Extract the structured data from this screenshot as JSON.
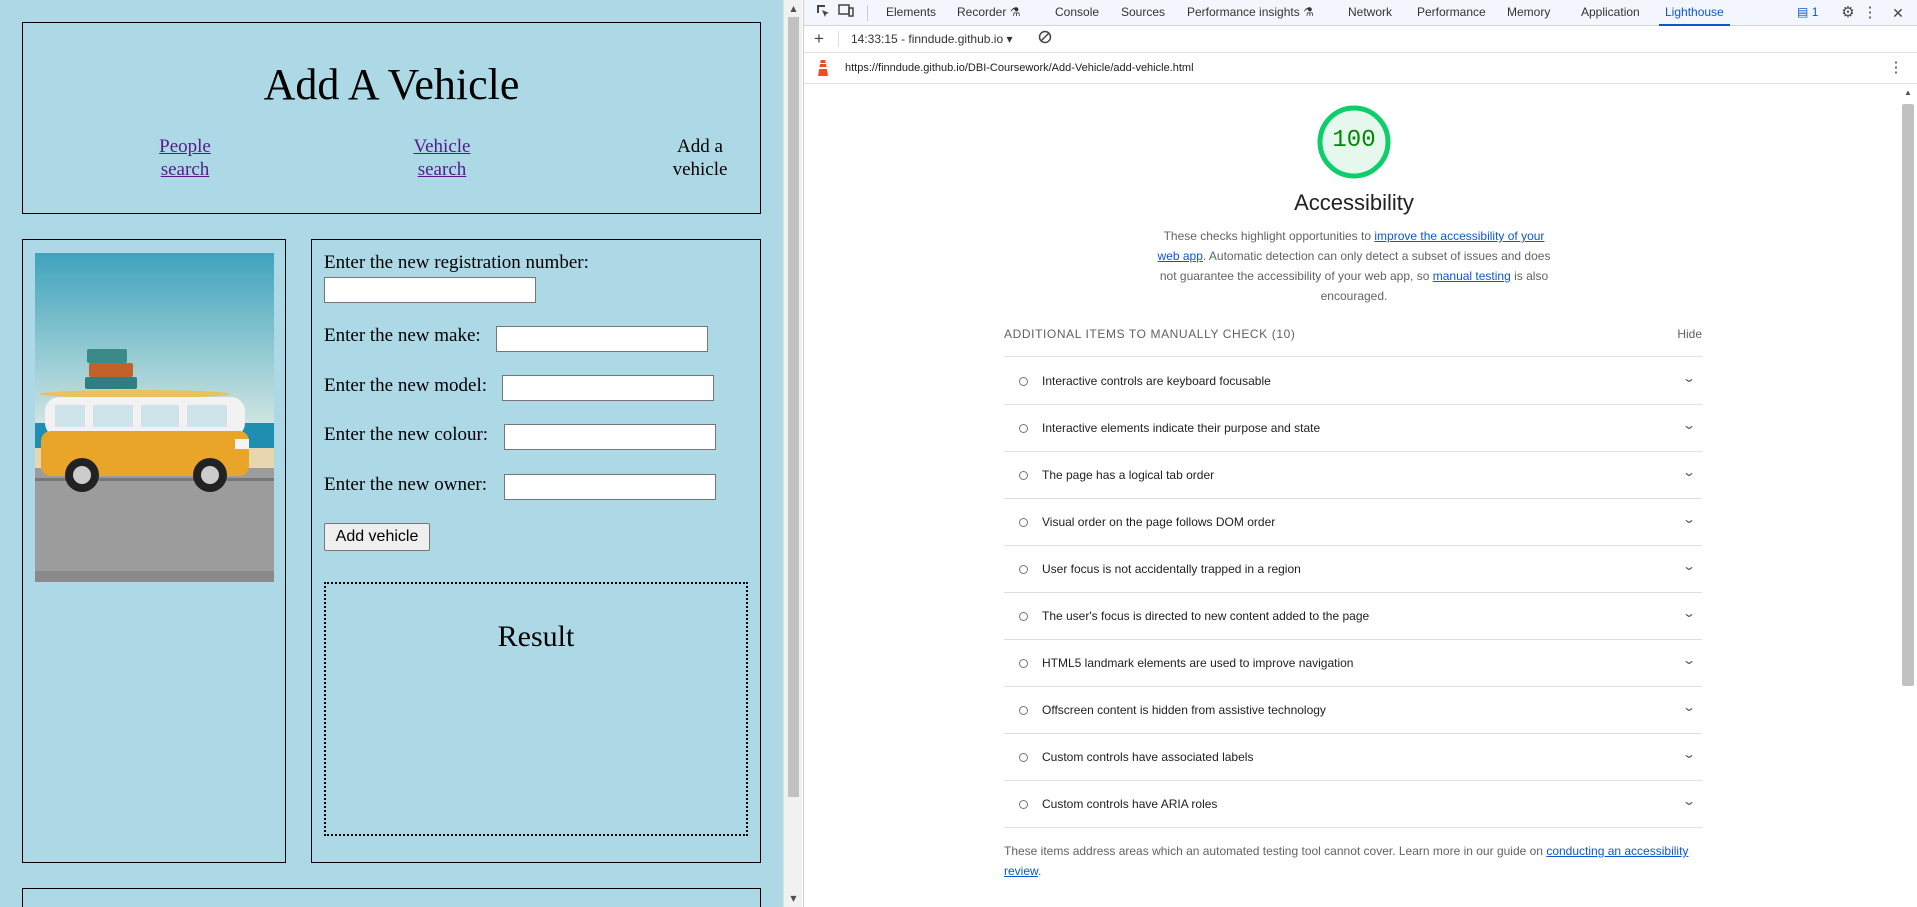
{
  "page": {
    "title": "Add A Vehicle",
    "nav": {
      "people_line1": "People",
      "people_line2": "search",
      "vehicle_line1": "Vehicle",
      "vehicle_line2": "search",
      "add_line1": "Add a",
      "add_line2": "vehicle"
    },
    "form": {
      "rego_label": "Enter the new registration number:",
      "make_label": "Enter the new make:",
      "model_label": "Enter the new model:",
      "colour_label": "Enter the new colour:",
      "owner_label": "Enter the new owner:",
      "rego_value": "",
      "make_value": "",
      "model_value": "",
      "colour_value": "",
      "owner_value": "",
      "submit_label": "Add vehicle"
    },
    "result_title": "Result",
    "colors": {
      "background": "#add8e6",
      "link": "#551a8b"
    }
  },
  "devtools": {
    "tabs": [
      "Elements",
      "Recorder",
      "Console",
      "Sources",
      "Performance insights",
      "Network",
      "Performance",
      "Memory",
      "Application",
      "Lighthouse"
    ],
    "active_tab": "Lighthouse",
    "issues_count": "1",
    "report_label": "14:33:15 - finndude.github.io",
    "url": "https://finndude.github.io/DBI-Coursework/Add-Vehicle/add-vehicle.html",
    "icons": [
      "inspect-icon",
      "device-toolbar-icon",
      "flask-icon",
      "issues-icon",
      "settings-icon",
      "more-vert-icon",
      "plus-icon",
      "clear-icon",
      "lighthouse-logo-icon"
    ]
  },
  "lighthouse": {
    "score": "100",
    "score_color": "#0cce6b",
    "category": "Accessibility",
    "desc_1": "These checks highlight opportunities to ",
    "desc_link_1": "improve the accessibility of your web app",
    "desc_2": ". Automatic detection can only detect a subset of issues and does not guarantee the accessibility of your web app, so ",
    "desc_link_2": "manual testing",
    "desc_3": " is also encouraged.",
    "manual_title": "ADDITIONAL ITEMS TO MANUALLY CHECK (10)",
    "hide_label": "Hide",
    "audits": [
      "Interactive controls are keyboard focusable",
      "Interactive elements indicate their purpose and state",
      "The page has a logical tab order",
      "Visual order on the page follows DOM order",
      "User focus is not accidentally trapped in a region",
      "The user's focus is directed to new content added to the page",
      "HTML5 landmark elements are used to improve navigation",
      "Offscreen content is hidden from assistive technology",
      "Custom controls have associated labels",
      "Custom controls have ARIA roles"
    ],
    "guide_text": "These items address areas which an automated testing tool cannot cover. Learn more in our guide on ",
    "guide_link": "conducting an accessibility review",
    "guide_end": "."
  }
}
